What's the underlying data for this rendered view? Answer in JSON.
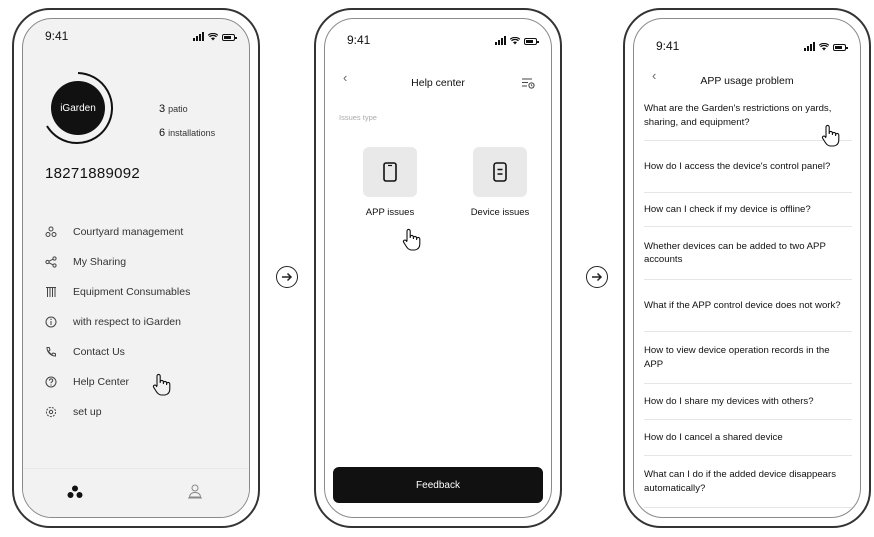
{
  "status_time": "9:41",
  "screen1": {
    "logo_text": "iGarden",
    "stats": [
      {
        "value": "3",
        "label": "patio"
      },
      {
        "value": "6",
        "label": "installations"
      }
    ],
    "phone_number": "18271889092",
    "menu": [
      {
        "label": "Courtyard management",
        "icon": "courtyard-icon"
      },
      {
        "label": "My Sharing",
        "icon": "share-icon"
      },
      {
        "label": "Equipment Consumables",
        "icon": "consumables-icon"
      },
      {
        "label": "with respect to iGarden",
        "icon": "info-icon"
      },
      {
        "label": "Contact Us",
        "icon": "phone-icon"
      },
      {
        "label": "Help Center",
        "icon": "help-icon"
      },
      {
        "label": "set up",
        "icon": "settings-icon"
      }
    ]
  },
  "screen2": {
    "title": "Help center",
    "section_label": "Issues type",
    "tiles": [
      {
        "label": "APP issues",
        "icon": "phone-device-icon"
      },
      {
        "label": "Device issues",
        "icon": "device-icon"
      }
    ],
    "feedback_label": "Feedback"
  },
  "screen3": {
    "title": "APP usage problem",
    "faqs": [
      "What are the Garden's restrictions on yards, sharing, and equipment?",
      "How do I access the device's control panel?",
      "How can I check if my device is offline?",
      "Whether devices can be added to two APP accounts",
      "What if the APP control device does not work?",
      "How to view device operation records in the APP",
      "How do I share my devices with others?",
      "How do I cancel a shared device",
      "What can I do if the added device disappears automatically?"
    ]
  }
}
